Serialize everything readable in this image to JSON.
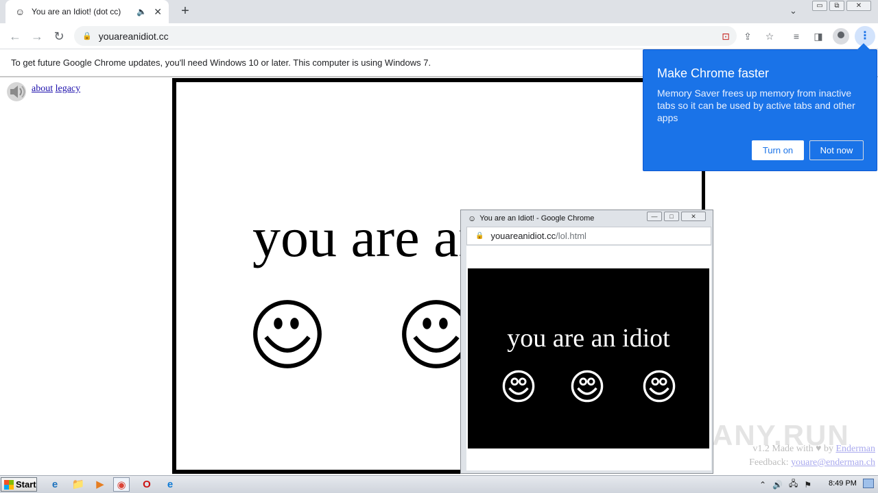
{
  "browser": {
    "tab": {
      "title": "You are an Idiot! (dot cc)",
      "favicon": "☺",
      "audio_icon": "🔈",
      "close": "✕"
    },
    "new_tab": "+",
    "tab_dropdown": "⌄",
    "window_controls": {
      "minimize": "▭",
      "restore": "⧉",
      "close": "✕"
    },
    "nav": {
      "back": "←",
      "forward": "→",
      "reload": "↻"
    },
    "omnibox": {
      "url": "youareanidiot.cc",
      "lock": "🔒"
    },
    "toolbar_icons": {
      "blocked_popup": "⊡",
      "share": "⇪",
      "bookmark": "☆",
      "media": "≡",
      "side_panel": "◨",
      "menu": "⋮"
    },
    "infobar": "To get future Google Chrome updates, you'll need Windows 10 or later. This computer is using Windows 7."
  },
  "page": {
    "links": {
      "about": "about",
      "legacy": "legacy"
    },
    "headline": "you are an idiot",
    "credits": {
      "made_prefix": "v1.2 Made with",
      "heart": "♥",
      "by": "by",
      "author": "Enderman",
      "feedback_label": "Feedback:",
      "feedback_email": "youare@enderman.ch"
    },
    "watermark": "ANY.RUN"
  },
  "popup": {
    "title": "You are an Idiot! - Google Chrome",
    "favicon": "☺",
    "url_host": "youareanidiot.cc",
    "url_path": "/lol.html",
    "text": "you are an idiot",
    "controls": {
      "minimize": "—",
      "restore": "□",
      "close": "✕"
    }
  },
  "bubble": {
    "title": "Make Chrome faster",
    "description": "Memory Saver frees up memory from inactive tabs so it can be used by active tabs and other apps",
    "turn_on": "Turn on",
    "not_now": "Not now"
  },
  "taskbar": {
    "start": "Start",
    "apps": [
      "e",
      "📁",
      "▶",
      "◉",
      "O",
      "e"
    ],
    "tray_icons": [
      "⌃",
      "🔊",
      "🖧",
      "⚑"
    ],
    "clock": "8:49 PM"
  },
  "colors": {
    "chrome_blue": "#1a73e8",
    "tab_strip": "#dee1e6",
    "taskbar": "#d6dbe3"
  }
}
